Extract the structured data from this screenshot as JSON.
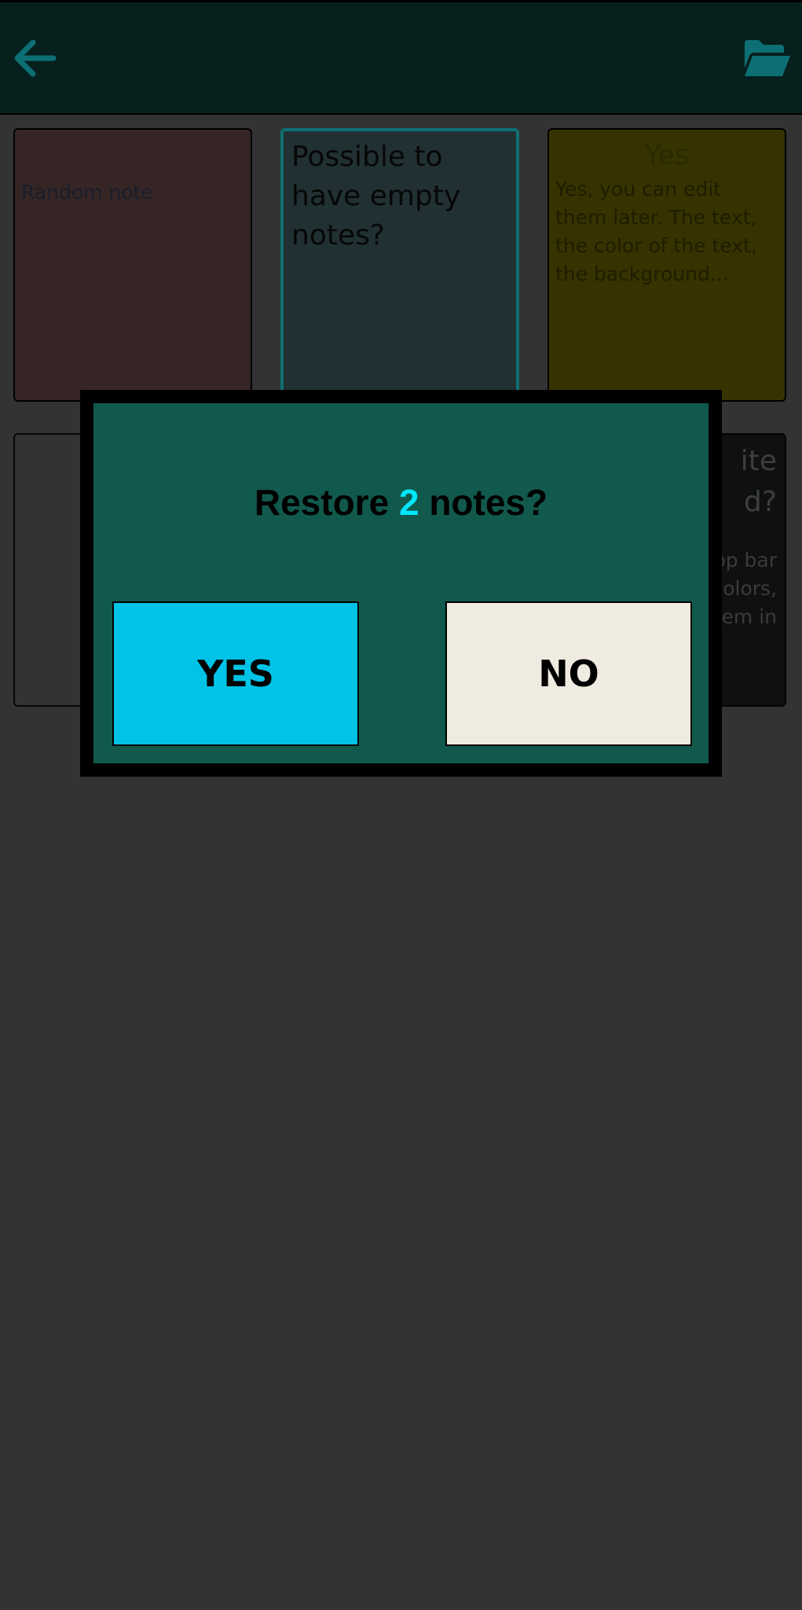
{
  "app_bar": {
    "back_icon": "arrow-left-icon",
    "folder_icon": "folder-open-icon",
    "accent_color": "#0d6f73"
  },
  "notes": [
    {
      "title": "",
      "body": "Random note"
    },
    {
      "title": "Possible to have empty notes?",
      "body": ""
    },
    {
      "title": "Yes",
      "body": "Yes, you can edit them later. The text, the color of the text, the background..."
    },
    {
      "title": "",
      "body": ""
    },
    {
      "title_lines": [
        "ite",
        "d?"
      ],
      "body_lines": [
        "pp bar",
        "olors,",
        "em in"
      ]
    }
  ],
  "dialog": {
    "title_prefix": "Restore ",
    "count": "2",
    "title_suffix": " notes?",
    "yes_label": "YES",
    "no_label": "NO",
    "count_color": "#00e6ff",
    "yes_color": "#00c3e6",
    "no_color": "#efebe0",
    "background_color": "#11594c"
  }
}
